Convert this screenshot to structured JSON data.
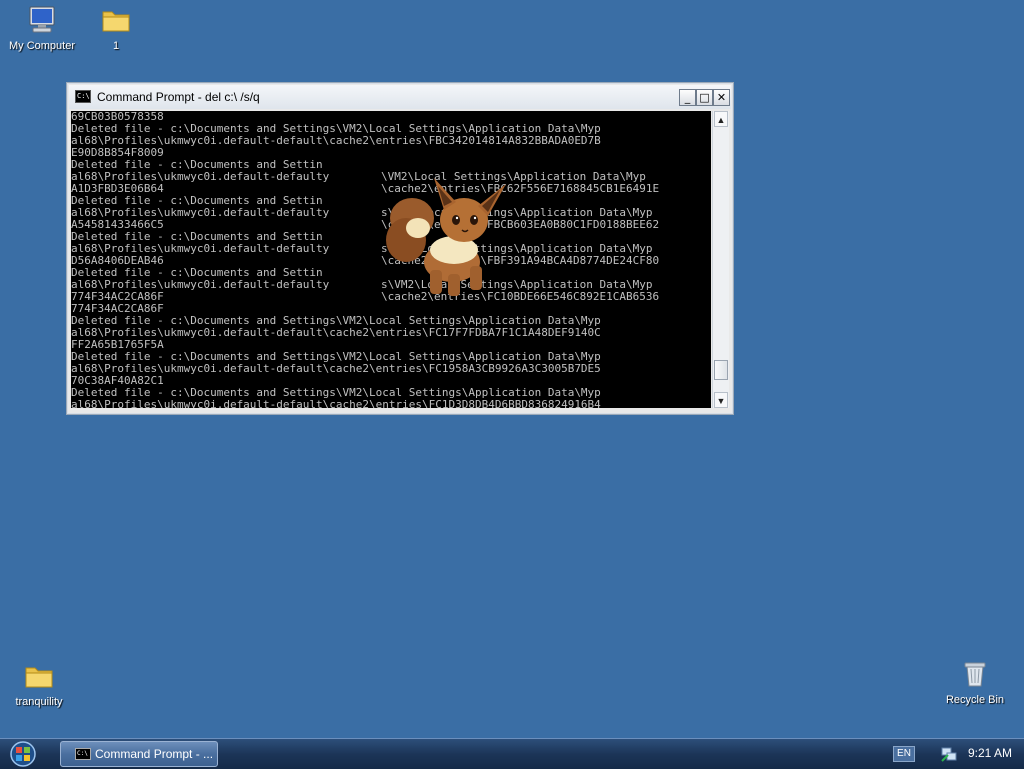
{
  "desktop": {
    "icons": {
      "my_computer": "My Computer",
      "folder_1": "1",
      "tranquility": "tranquility",
      "recycle_bin": "Recycle Bin"
    }
  },
  "window": {
    "title": "Command Prompt - del c:\\ /s/q",
    "icon_label": "C:\\",
    "controls": {
      "minimize": "_",
      "maximize": "□",
      "close": "✕"
    },
    "console_lines": [
      "69CB03B0578358",
      "Deleted file - c:\\Documents and Settings\\VM2\\Local Settings\\Application Data\\Myp",
      "al68\\Profiles\\ukmwyc0i.default-default\\cache2\\entries\\FBC342014814A832BBADA0ED7B",
      "E90D8B854F8009",
      "Deleted file - c:\\Documents and Settin",
      "al68\\Profiles\\ukmwyc0i.default-defaulty",
      "A1D3FBD3E06B64",
      "Deleted file - c:\\Documents and Settin",
      "al68\\Profiles\\ukmwyc0i.default-defaulty",
      "A54581433466C5",
      "Deleted file - c:\\Documents and Settin",
      "al68\\Profiles\\ukmwyc0i.default-defaulty",
      "D56A8406DEAB46",
      "Deleted file - c:\\Documents and Settin",
      "al68\\Profiles\\ukmwyc0i.default-defaulty",
      "774F34AC2CA86F",
      "774F34AC2CA86F",
      "Deleted file - c:\\Documents and Settings\\VM2\\Local Settings\\Application Data\\Myp",
      "al68\\Profiles\\ukmwyc0i.default-default\\cache2\\entries\\FC17F7FDBA7F1C1A48DEF9140C",
      "FF2A65B1765F5A",
      "Deleted file - c:\\Documents and Settings\\VM2\\Local Settings\\Application Data\\Myp",
      "al68\\Profiles\\ukmwyc0i.default-default\\cache2\\entries\\FC1958A3CB9926A3C3005B7DE5",
      "70C38AF40A82C1",
      "Deleted file - c:\\Documents and Settings\\VM2\\Local Settings\\Application Data\\Myp",
      "al68\\Profiles\\ukmwyc0i.default-default\\cache2\\entries\\FC1D3D8DB4D6BBD836824916B4"
    ],
    "console_fragments": [
      "\\VM2\\Local Settings\\Application Data\\Myp",
      "\\cache2\\entries\\FBC62F556E7168845CB1E6491E",
      "s\\VM2\\Local Settings\\Application Data\\Myp",
      "\\cache2\\entries\\FBCB603EA0B80C1FD0188BEE62",
      "s\\VM2\\Local Settings\\Application Data\\Myp",
      "\\cache2\\entries\\FBF391A94BCA4D8774DE24CF80",
      "s\\VM2\\Local Settings\\Application Data\\Myp",
      "\\cache2\\entries\\FC10BDE66E546C892E1CAB6536"
    ],
    "scroll": {
      "up": "▲",
      "down": "▼",
      "position": 0.95
    }
  },
  "taskbar": {
    "task_label": "Command Prompt - ...",
    "language": "EN",
    "clock": "9:21 AM"
  },
  "colors": {
    "desktop": "#3a6ea5",
    "console_bg": "#000000",
    "console_text": "#c0c0c0"
  }
}
